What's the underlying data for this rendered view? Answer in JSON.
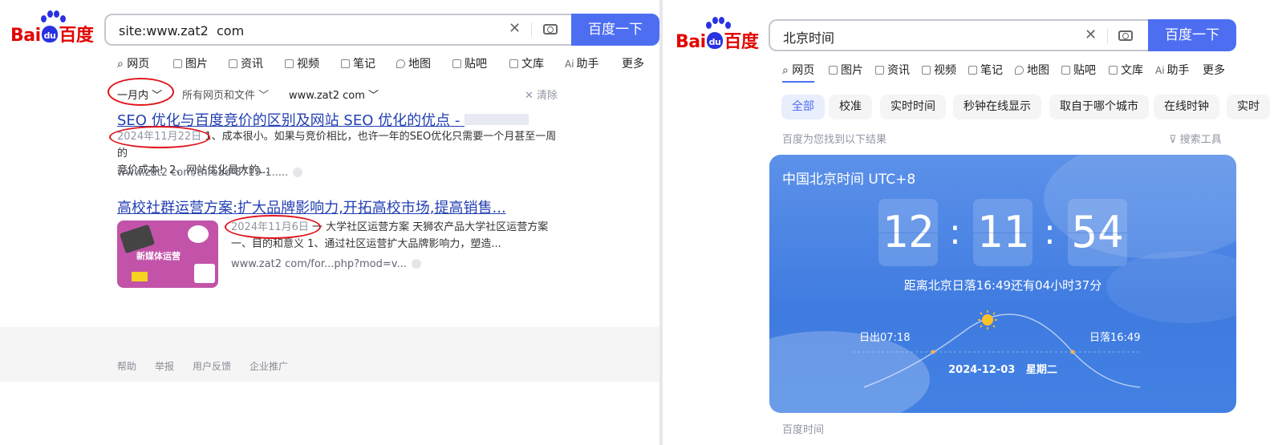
{
  "left": {
    "search": {
      "value": "site:www.zat2  com"
    },
    "search_button": "百度一下",
    "tabs": [
      {
        "label": "网页",
        "active": true
      },
      {
        "label": "图片"
      },
      {
        "label": "资讯"
      },
      {
        "label": "视频"
      },
      {
        "label": "笔记"
      },
      {
        "label": "地图"
      },
      {
        "label": "贴吧"
      },
      {
        "label": "文库"
      },
      {
        "label": "助手"
      },
      {
        "label": "更多"
      }
    ],
    "filters": {
      "time": "一月内",
      "type": "所有网页和文件",
      "site": "www.zat2  com",
      "clear": "清除"
    },
    "results": [
      {
        "title": "SEO 优化与百度竞价的区别及网站 SEO 优化的优点 -",
        "date": "2024年11月22日",
        "snippet_first": "1、成本很小。如果与竞价相比，也许一年的SEO优化只需要一个月甚至一周的",
        "snippet_second": "竞价成本！2、网站优化最大的...",
        "url": "www.zat2  com/thread-8719-1....."
      },
      {
        "title": "高校社群运营方案:扩大品牌影响力,开拓高校市场,提高销售...",
        "date": "2024年11月6日",
        "snippet_first": "一 大学社区运营方案 天狮农产品大学社区运营方案",
        "snippet_second": "一、目的和意义 1、通过社区运营扩大品牌影响力，塑造...",
        "url": "www.zat2  com/for...php?mod=v...",
        "thumb_text": "新媒体运营"
      }
    ],
    "footer": [
      "帮助",
      "举报",
      "用户反馈",
      "企业推广"
    ]
  },
  "right": {
    "search": {
      "value": "北京时间"
    },
    "search_button": "百度一下",
    "tabs": [
      {
        "label": "网页",
        "active": true
      },
      {
        "label": "图片"
      },
      {
        "label": "资讯"
      },
      {
        "label": "视频"
      },
      {
        "label": "笔记"
      },
      {
        "label": "地图"
      },
      {
        "label": "贴吧"
      },
      {
        "label": "文库"
      },
      {
        "label": "助手"
      },
      {
        "label": "更多"
      }
    ],
    "chips": [
      "全部",
      "校准",
      "实时时间",
      "秒钟在线显示",
      "取自于哪个城市",
      "在线时钟",
      "实时"
    ],
    "result_count": "百度为您找到以下结果",
    "search_tools": "搜索工具",
    "clock": {
      "title": "中国北京时间 UTC+8",
      "hours": "12",
      "minutes": "11",
      "seconds": "54",
      "sunset_text": "距离北京日落16:49还有04小时37分",
      "sunrise": "日出07:18",
      "sunset": "日落16:49",
      "date": "2024-12-03",
      "weekday": "星期二"
    },
    "source": "百度时间"
  },
  "logo": {
    "bai": "Bai",
    "du": "du",
    "cn": "百度"
  }
}
